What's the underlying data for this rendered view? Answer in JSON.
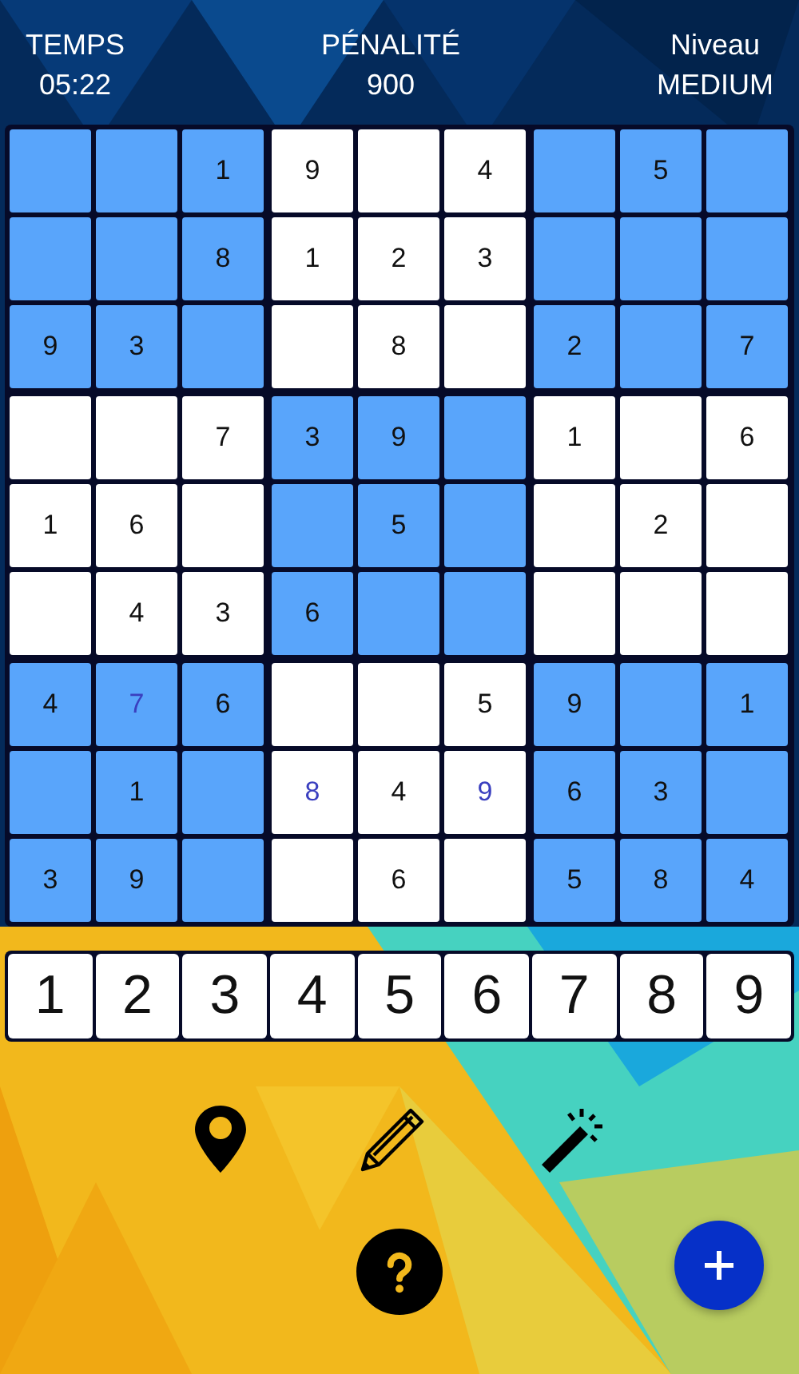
{
  "header": [
    {
      "label": "TEMPS",
      "value": "05:22"
    },
    {
      "label": "PÉNALITÉ",
      "value": "900"
    },
    {
      "label": "Niveau",
      "value": "MEDIUM"
    }
  ],
  "grid": [
    [
      {
        "highlighted": true
      },
      {
        "highlighted": true
      },
      {
        "value": "1",
        "kind": "given",
        "highlighted": true
      },
      {
        "value": "9",
        "kind": "given",
        "highlighted": false
      },
      {
        "highlighted": false
      },
      {
        "value": "4",
        "kind": "given",
        "highlighted": false
      },
      {
        "highlighted": true
      },
      {
        "value": "5",
        "kind": "given",
        "highlighted": true
      },
      {
        "highlighted": true
      }
    ],
    [
      {
        "highlighted": true
      },
      {
        "highlighted": true
      },
      {
        "value": "8",
        "kind": "given",
        "highlighted": true
      },
      {
        "value": "1",
        "kind": "given",
        "highlighted": false
      },
      {
        "value": "2",
        "kind": "given",
        "highlighted": false
      },
      {
        "value": "3",
        "kind": "given",
        "highlighted": false
      },
      {
        "highlighted": true
      },
      {
        "highlighted": true
      },
      {
        "highlighted": true
      }
    ],
    [
      {
        "value": "9",
        "kind": "given",
        "highlighted": true
      },
      {
        "value": "3",
        "kind": "given",
        "highlighted": true
      },
      {
        "highlighted": true
      },
      {
        "highlighted": false
      },
      {
        "value": "8",
        "kind": "given",
        "highlighted": false
      },
      {
        "highlighted": false
      },
      {
        "value": "2",
        "kind": "given",
        "highlighted": true
      },
      {
        "highlighted": true
      },
      {
        "value": "7",
        "kind": "given",
        "highlighted": true
      }
    ],
    [
      {
        "highlighted": false
      },
      {
        "highlighted": false
      },
      {
        "value": "7",
        "kind": "given",
        "highlighted": false
      },
      {
        "value": "3",
        "kind": "given",
        "highlighted": true
      },
      {
        "value": "9",
        "kind": "given",
        "highlighted": true
      },
      {
        "highlighted": true
      },
      {
        "value": "1",
        "kind": "given",
        "highlighted": false
      },
      {
        "highlighted": false
      },
      {
        "value": "6",
        "kind": "given",
        "highlighted": false
      }
    ],
    [
      {
        "value": "1",
        "kind": "given",
        "highlighted": false
      },
      {
        "value": "6",
        "kind": "given",
        "highlighted": false
      },
      {
        "highlighted": false
      },
      {
        "highlighted": true
      },
      {
        "value": "5",
        "kind": "given",
        "highlighted": true
      },
      {
        "highlighted": true
      },
      {
        "highlighted": false
      },
      {
        "value": "2",
        "kind": "given",
        "highlighted": false
      },
      {
        "highlighted": false
      }
    ],
    [
      {
        "highlighted": false
      },
      {
        "value": "4",
        "kind": "given",
        "highlighted": false
      },
      {
        "value": "3",
        "kind": "given",
        "highlighted": false
      },
      {
        "value": "6",
        "kind": "given",
        "highlighted": true
      },
      {
        "highlighted": true
      },
      {
        "highlighted": true
      },
      {
        "highlighted": false
      },
      {
        "highlighted": false
      },
      {
        "highlighted": false
      }
    ],
    [
      {
        "value": "4",
        "kind": "given",
        "highlighted": true
      },
      {
        "value": "7",
        "kind": "entered",
        "highlighted": true
      },
      {
        "value": "6",
        "kind": "given",
        "highlighted": true
      },
      {
        "highlighted": false
      },
      {
        "highlighted": false
      },
      {
        "value": "5",
        "kind": "given",
        "highlighted": false
      },
      {
        "value": "9",
        "kind": "given",
        "highlighted": true
      },
      {
        "highlighted": true
      },
      {
        "value": "1",
        "kind": "given",
        "highlighted": true
      }
    ],
    [
      {
        "highlighted": true
      },
      {
        "value": "1",
        "kind": "given",
        "highlighted": true
      },
      {
        "highlighted": true
      },
      {
        "value": "8",
        "kind": "entered",
        "highlighted": false
      },
      {
        "value": "4",
        "kind": "given",
        "highlighted": false
      },
      {
        "value": "9",
        "kind": "entered",
        "highlighted": false
      },
      {
        "value": "6",
        "kind": "given",
        "highlighted": true
      },
      {
        "value": "3",
        "kind": "given",
        "highlighted": true
      },
      {
        "highlighted": true
      }
    ],
    [
      {
        "value": "3",
        "kind": "given",
        "highlighted": true
      },
      {
        "value": "9",
        "kind": "given",
        "highlighted": true
      },
      {
        "highlighted": true
      },
      {
        "highlighted": false
      },
      {
        "value": "6",
        "kind": "given",
        "highlighted": false
      },
      {
        "highlighted": false
      },
      {
        "value": "5",
        "kind": "given",
        "highlighted": true
      },
      {
        "value": "8",
        "kind": "given",
        "highlighted": true
      },
      {
        "value": "4",
        "kind": "given",
        "highlighted": true
      }
    ]
  ],
  "number_pad": [
    "1",
    "2",
    "3",
    "4",
    "5",
    "6",
    "7",
    "8",
    "9"
  ]
}
